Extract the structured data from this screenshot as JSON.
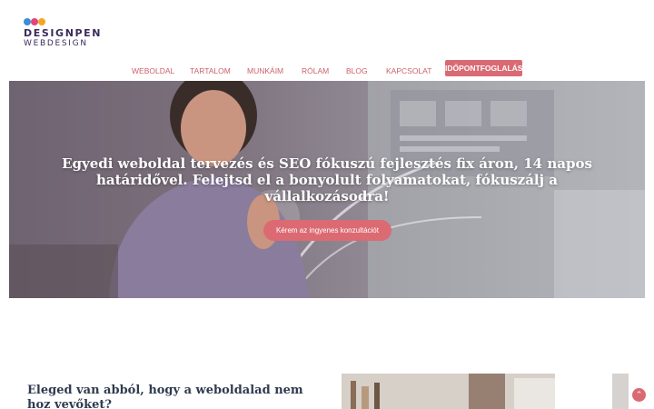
{
  "brand": {
    "line1": "DESIGNPEN",
    "line2": "WEBDESIGN",
    "dot_colors": [
      "#3a8fd6",
      "#e0457b",
      "#f4a623"
    ],
    "text_color": "#3b2a5c"
  },
  "nav": {
    "items": [
      "WEBOLDAL",
      "TARTALOM",
      "MUNKÁIM",
      "RÓLAM",
      "BLOG",
      "KAPCSOLAT"
    ],
    "cta": "IDŐPONTFOGLALÁS",
    "color": "#c9626b"
  },
  "hero": {
    "title": "Egyedi weboldal tervezés és SEO fókuszú fejlesztés fix áron, 14 napos határidővel. Felejtsd el a bonyolult folyamatokat, fókuszálj a vállalkozásodra!",
    "button": "Kérem az ingyenes konzultációt",
    "accent": "#dc6a73"
  },
  "section": {
    "title": "Eleged van abból, hogy a weboldalad nem hoz vevőket?"
  },
  "scroll_top": {
    "icon": "chevron-up-icon"
  }
}
